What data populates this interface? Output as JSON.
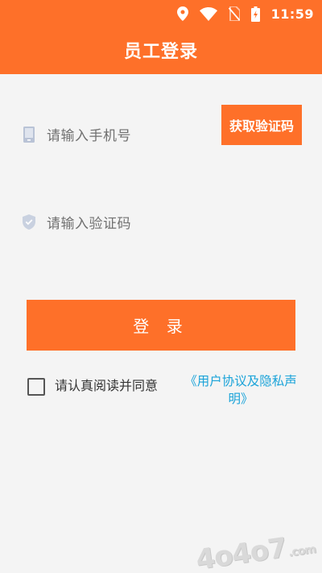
{
  "status_bar": {
    "time": "11:59",
    "icons": [
      "location-icon",
      "wifi-icon",
      "no-sim-icon",
      "battery-charging-icon"
    ]
  },
  "header": {
    "title": "员工登录"
  },
  "form": {
    "phone_placeholder": "请输入手机号",
    "code_placeholder": "请输入验证码",
    "get_code_label": "获取验证码",
    "login_label": "登 录"
  },
  "agreement": {
    "checked": false,
    "text": "请认真阅读并同意",
    "link_line1": "《用户协议及隐私声",
    "link_line2": "明》"
  },
  "watermark": {
    "text": "4o4o7",
    "suffix": ".com"
  },
  "colors": {
    "accent": "#fe7029",
    "link": "#1aa3d9",
    "background": "#f4f4f4",
    "placeholder_text": "#707070"
  }
}
